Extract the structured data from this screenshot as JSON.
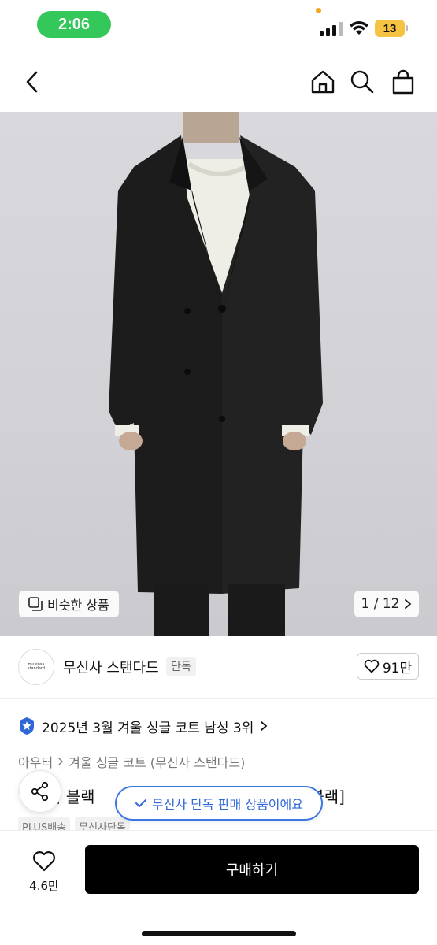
{
  "status_bar": {
    "time": "2:06",
    "battery": "13",
    "time_pill_color": "#34c759",
    "battery_color": "#f5c242"
  },
  "nav": {
    "icons": [
      "back-icon",
      "home-icon",
      "search-icon",
      "shopping-bag-icon"
    ]
  },
  "product_image": {
    "similar_label": "비슷한 상품",
    "pager": "1 / 12"
  },
  "brand": {
    "logo_text": "musinsa standard",
    "name": "무신사 스탠다드",
    "badge": "단독",
    "likes": "91만"
  },
  "ranking": {
    "text": "2025년 3월 겨울 싱글 코트 남성 3위"
  },
  "category": {
    "parent": "아우터",
    "child": "겨울 싱글 코트 (무신사 스탠다드)"
  },
  "product": {
    "title_visible": "어 블랙",
    "title_suffix": "[블랙]"
  },
  "tags": [
    "PLUS배송",
    "무신사단독"
  ],
  "toast": {
    "text": "무신사 단독 판매 상품이에요",
    "color": "#3b76e1"
  },
  "bottom_bar": {
    "wish_count": "4.6만",
    "buy_label": "구매하기",
    "buy_color": "#000000"
  }
}
